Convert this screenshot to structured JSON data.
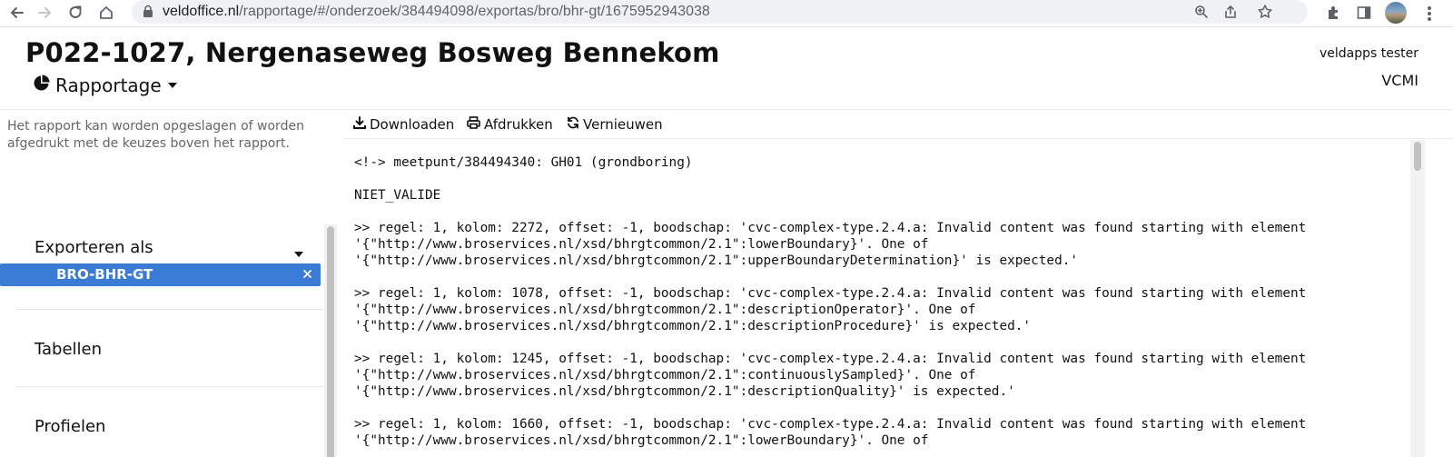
{
  "browser": {
    "url_host": "veldoffice.nl",
    "url_path": "/rapportage/#/onderzoek/384494098/exportas/bro/bhr-gt/1675952943038"
  },
  "header": {
    "title": "P022-1027, Nergenaseweg Bosweg Bennekom",
    "menu_label": "Rapportage",
    "user": "veldapps tester",
    "org": "VCMI"
  },
  "sidebar": {
    "help_text": "Het rapport kan worden opgeslagen of worden afgedrukt met de keuzes boven het rapport.",
    "export_section": "Exporteren als",
    "selected_export": "BRO-BHR-GT",
    "tables_section": "Tabellen",
    "profiles_section": "Profielen"
  },
  "toolbar": {
    "download": "Downloaden",
    "print": "Afdrukken",
    "refresh": "Vernieuwen"
  },
  "report": {
    "lines": [
      "<!-> meetpunt/384494340: GH01 (grondboring)",
      "NIET_VALIDE",
      ">> regel: 1, kolom: 2272, offset: -1, boodschap: 'cvc-complex-type.2.4.a: Invalid content was found starting with element",
      "'{\"http://www.broservices.nl/xsd/bhrgtcommon/2.1\":lowerBoundary}'. One of",
      "'{\"http://www.broservices.nl/xsd/bhrgtcommon/2.1\":upperBoundaryDetermination}' is expected.'",
      ">> regel: 1, kolom: 1078, offset: -1, boodschap: 'cvc-complex-type.2.4.a: Invalid content was found starting with element",
      "'{\"http://www.broservices.nl/xsd/bhrgtcommon/2.1\":descriptionOperator}'. One of",
      "'{\"http://www.broservices.nl/xsd/bhrgtcommon/2.1\":descriptionProcedure}' is expected.'",
      ">> regel: 1, kolom: 1245, offset: -1, boodschap: 'cvc-complex-type.2.4.a: Invalid content was found starting with element",
      "'{\"http://www.broservices.nl/xsd/bhrgtcommon/2.1\":continuouslySampled}'. One of",
      "'{\"http://www.broservices.nl/xsd/bhrgtcommon/2.1\":descriptionQuality}' is expected.'",
      ">> regel: 1, kolom: 1660, offset: -1, boodschap: 'cvc-complex-type.2.4.a: Invalid content was found starting with element",
      "'{\"http://www.broservices.nl/xsd/bhrgtcommon/2.1\":lowerBoundary}'. One of"
    ]
  },
  "colors": {
    "selected_bg": "#3a7bd5",
    "text": "#111111",
    "muted": "#666666"
  }
}
